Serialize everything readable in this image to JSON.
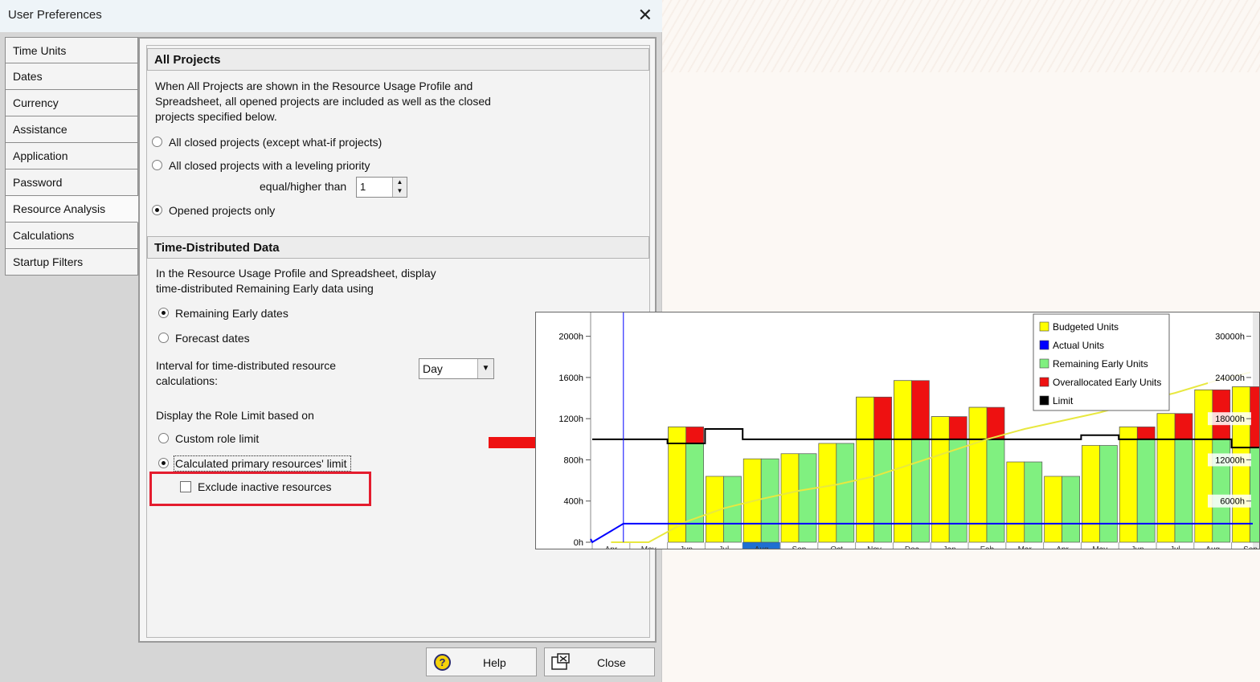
{
  "window": {
    "title": "User Preferences",
    "close_glyph": "✕"
  },
  "nav": {
    "items": [
      {
        "label": "Time Units"
      },
      {
        "label": "Dates"
      },
      {
        "label": "Currency"
      },
      {
        "label": "Assistance"
      },
      {
        "label": "Application"
      },
      {
        "label": "Password"
      },
      {
        "label": "Resource Analysis"
      },
      {
        "label": "Calculations"
      },
      {
        "label": "Startup Filters"
      }
    ],
    "active": "Resource Analysis"
  },
  "all_projects": {
    "heading": "All Projects",
    "desc_line1": "When All Projects are shown in the Resource Usage Profile and",
    "desc_line2": "Spreadsheet, all opened projects are included as well as the closed",
    "desc_line3": "projects specified below.",
    "opt1": "All closed projects (except what-if projects)",
    "opt2": "All closed projects with a leveling priority",
    "equal_label": "equal/higher than",
    "priority_value": "1",
    "opt3": "Opened projects only",
    "selected": "opt3"
  },
  "time_distributed": {
    "heading": "Time-Distributed Data",
    "desc_line1": "In the Resource Usage Profile and Spreadsheet, display",
    "desc_line2": "time-distributed Remaining Early data using",
    "opt_remaining": "Remaining Early dates",
    "opt_forecast": "Forecast dates",
    "selected": "opt_remaining",
    "interval_label1": "Interval for time-distributed resource",
    "interval_label2": "calculations:",
    "interval_value": "Day",
    "role_limit_label": "Display the Role Limit based on",
    "opt_custom": "Custom role limit",
    "opt_calculated": "Calculated primary resources' limit",
    "role_selected": "opt_calculated",
    "exclude_label": "Exclude inactive resources",
    "exclude_checked": false
  },
  "footer": {
    "help_label": "Help",
    "close_label": "Close"
  },
  "colors": {
    "budgeted": "#ffff00",
    "actual": "#0000ff",
    "remaining": "#80f080",
    "overallocated": "#ee1111",
    "limit": "#000000",
    "highlight": "#e41c2e"
  },
  "chart_data": {
    "type": "bar",
    "legend": [
      "Budgeted Units",
      "Actual Units",
      "Remaining Early Units",
      "Overallocated Early Units",
      "Limit"
    ],
    "legend_position": "top-right",
    "y_left_ticks": [
      "0h",
      "400h",
      "800h",
      "1200h",
      "1600h",
      "2000h"
    ],
    "y_right_ticks": [
      "6000h",
      "12000h",
      "18000h",
      "24000h",
      "30000h"
    ],
    "ylim": [
      0,
      2200
    ],
    "categories": [
      "Apr",
      "May",
      "Jun",
      "Jul",
      "Aug",
      "Sep",
      "Oct",
      "Nov",
      "Dec",
      "Jan",
      "Feb",
      "Mar",
      "Apr",
      "May",
      "Jun",
      "Jul",
      "Aug",
      "Sep"
    ],
    "highlighted_category": "Aug",
    "budgeted": [
      0,
      0,
      1120,
      640,
      810,
      860,
      960,
      1410,
      1570,
      1220,
      1310,
      780,
      640,
      940,
      1120,
      1250,
      1480,
      1510
    ],
    "remaining": [
      0,
      0,
      1120,
      640,
      810,
      860,
      960,
      1410,
      1570,
      1220,
      1310,
      780,
      640,
      940,
      1120,
      1250,
      1480,
      1510
    ],
    "limit": [
      1000,
      1000,
      960,
      1100,
      1000,
      1000,
      1000,
      1000,
      1000,
      1000,
      1000,
      1000,
      1000,
      1040,
      1000,
      1000,
      1000,
      920
    ],
    "actual_units": [
      0,
      180,
      180,
      180,
      180,
      180,
      180,
      180,
      180,
      180,
      180,
      180,
      180,
      180,
      180,
      180,
      180,
      180
    ],
    "cumulative": [
      0,
      0,
      200,
      330,
      420,
      500,
      560,
      640,
      760,
      880,
      1000,
      1100,
      1180,
      1260,
      1360,
      1450,
      1560,
      1650
    ]
  }
}
